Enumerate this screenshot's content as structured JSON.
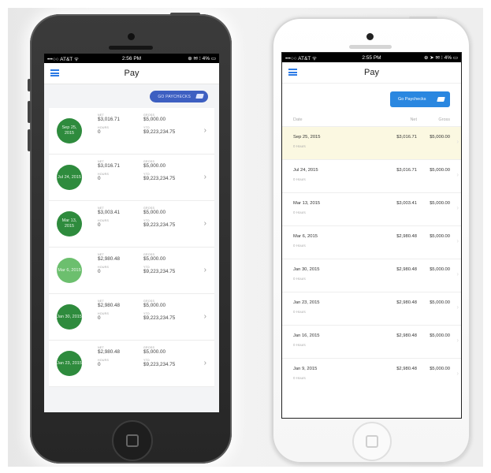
{
  "screens": {
    "dark": {
      "status": {
        "carrier": "•••○○ AT&T ᯤ",
        "time": "2:56 PM",
        "right": "⊕ ✉ ⁝ 4% ▭"
      },
      "nav_title": "Pay",
      "paychecks_button": "GO PAYCHECKS",
      "labels": {
        "net": "NET",
        "gross": "GROSS",
        "hours": "HOURS",
        "ytd": "YTD"
      },
      "cards": [
        {
          "date": "Sep 25, 2015",
          "net": "$3,016.71",
          "gross": "$5,000.00",
          "hours": "0",
          "ytd": "$9,223,234.75"
        },
        {
          "date": "Jul 24, 2015",
          "net": "$3,016.71",
          "gross": "$5,000.00",
          "hours": "0",
          "ytd": "$9,223,234.75"
        },
        {
          "date": "Mar 13, 2015",
          "net": "$3,003.41",
          "gross": "$5,000.00",
          "hours": "0",
          "ytd": "$9,223,234.75"
        },
        {
          "date": "Mar 6, 2015",
          "net": "$2,980.48",
          "gross": "$5,000.00",
          "hours": "0",
          "ytd": "$9,223,234.75"
        },
        {
          "date": "Jan 30, 2015",
          "net": "$2,980.48",
          "gross": "$5,000.00",
          "hours": "0",
          "ytd": "$9,223,234.75"
        },
        {
          "date": "Jan 23, 2015",
          "net": "$2,980.48",
          "gross": "$5,000.00",
          "hours": "0",
          "ytd": "$9,223,234.75"
        }
      ]
    },
    "light": {
      "status": {
        "carrier": "•••○○ AT&T ᯤ",
        "time": "2:55 PM",
        "right": "⊕ ➤ ✉ ⁝ 4% ▭"
      },
      "nav_title": "Pay",
      "paychecks_button": "Go Paychecks",
      "headers": {
        "date": "Date",
        "net": "Net",
        "gross": "Gross"
      },
      "rows": [
        {
          "date": "Sep 25, 2015",
          "hours": "0 Hours",
          "net": "$3,016.71",
          "gross": "$5,000.00"
        },
        {
          "date": "Jul 24, 2015",
          "hours": "0 Hours",
          "net": "$3,016.71",
          "gross": "$5,000.00"
        },
        {
          "date": "Mar 13, 2015",
          "hours": "0 Hours",
          "net": "$3,003.41",
          "gross": "$5,000.00"
        },
        {
          "date": "Mar 6, 2015",
          "hours": "0 Hours",
          "net": "$2,980.48",
          "gross": "$5,000.00"
        },
        {
          "date": "Jan 30, 2015",
          "hours": "0 Hours",
          "net": "$2,980.48",
          "gross": "$5,000.00"
        },
        {
          "date": "Jan 23, 2015",
          "hours": "0 Hours",
          "net": "$2,980.48",
          "gross": "$5,000.00"
        },
        {
          "date": "Jan 16, 2015",
          "hours": "0 Hours",
          "net": "$2,980.48",
          "gross": "$5,000.00"
        },
        {
          "date": "Jan 9, 2015",
          "hours": "0 Hours",
          "net": "$2,980.48",
          "gross": "$5,000.00"
        }
      ]
    }
  },
  "colors": {
    "accent": "#2a87e0",
    "pill": "#3d5fc1",
    "paid_green": "#2e8b3d",
    "selected_row": "#fbf8e1"
  }
}
